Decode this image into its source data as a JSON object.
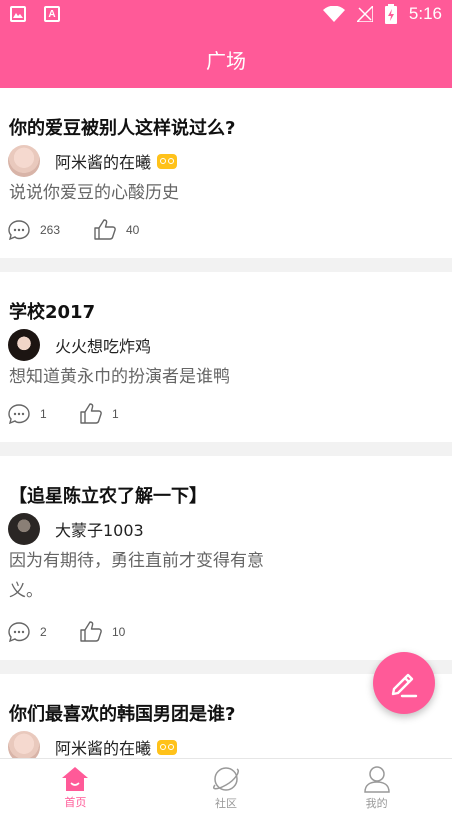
{
  "status_bar": {
    "time": "5:16"
  },
  "header": {
    "title": "广场"
  },
  "posts": [
    {
      "title": "你的爱豆被别人这样说过么?",
      "author": "阿米酱的在曦",
      "vip": true,
      "description": "说说你爱豆的心酸历史",
      "comments": "263",
      "likes": "40"
    },
    {
      "title": "学校2017",
      "author": "火火想吃炸鸡",
      "vip": false,
      "description": "想知道黄永巾的扮演者是谁鸭",
      "comments": "1",
      "likes": "1"
    },
    {
      "title": "【追星陈立农了解一下】",
      "author": "大蒙子1003",
      "vip": false,
      "description": "因为有期待，勇往直前才变得有意义。",
      "comments": "2",
      "likes": "10"
    },
    {
      "title": "你们最喜欢的韩国男团是谁?",
      "author": "阿米酱的在曦",
      "vip": true
    }
  ],
  "tabs": [
    {
      "label": "首页",
      "icon": "home-icon",
      "active": true
    },
    {
      "label": "社区",
      "icon": "planet-icon",
      "active": false
    },
    {
      "label": "我的",
      "icon": "user-icon",
      "active": false
    }
  ],
  "colors": {
    "accent": "#ff5a98",
    "vip_badge": "#ffc21a"
  }
}
